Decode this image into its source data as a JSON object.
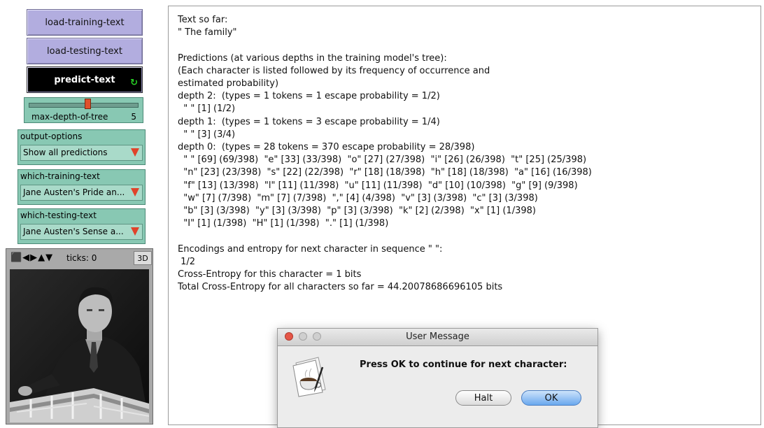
{
  "buttons": {
    "load_training": "load-training-text",
    "load_testing": "load-testing-text",
    "predict": "predict-text"
  },
  "slider": {
    "name": "max-depth-of-tree",
    "value": "5"
  },
  "choosers": {
    "output_options": {
      "label": "output-options",
      "selected": "Show all predictions"
    },
    "training_text": {
      "label": "which-training-text",
      "selected": "Jane Austen's Pride an..."
    },
    "testing_text": {
      "label": "which-testing-text",
      "selected": "Jane Austen's Sense a..."
    }
  },
  "view": {
    "ticks": "ticks: 0",
    "three_d": "3D"
  },
  "output_lines": [
    "Text so far:",
    "\" The family\"",
    "",
    "Predictions (at various depths in the training model's tree):",
    "(Each character is listed followed by its frequency of occurrence and",
    "estimated probability)",
    "depth 2:  (types = 1 tokens = 1 escape probability = 1/2)",
    "  \" \" [1] (1/2)",
    "depth 1:  (types = 1 tokens = 3 escape probability = 1/4)",
    "  \" \" [3] (3/4)",
    "depth 0:  (types = 28 tokens = 370 escape probability = 28/398)",
    "  \" \" [69] (69/398)  \"e\" [33] (33/398)  \"o\" [27] (27/398)  \"i\" [26] (26/398)  \"t\" [25] (25/398)",
    "  \"n\" [23] (23/398)  \"s\" [22] (22/398)  \"r\" [18] (18/398)  \"h\" [18] (18/398)  \"a\" [16] (16/398)",
    "  \"f\" [13] (13/398)  \"l\" [11] (11/398)  \"u\" [11] (11/398)  \"d\" [10] (10/398)  \"g\" [9] (9/398)",
    "  \"w\" [7] (7/398)  \"m\" [7] (7/398)  \",\" [4] (4/398)  \"v\" [3] (3/398)  \"c\" [3] (3/398)",
    "  \"b\" [3] (3/398)  \"y\" [3] (3/398)  \"p\" [3] (3/398)  \"k\" [2] (2/398)  \"x\" [1] (1/398)",
    "  \"I\" [1] (1/398)  \"H\" [1] (1/398)  \".\" [1] (1/398)",
    "",
    "Encodings and entropy for next character in sequence \" \":",
    " 1/2",
    "Cross-Entropy for this character = 1 bits",
    "Total Cross-Entropy for all characters so far = 44.20078686696105 bits"
  ],
  "dialog": {
    "title": "User Message",
    "message": "Press OK to continue for next character:",
    "halt": "Halt",
    "ok": "OK"
  },
  "icons": {
    "view_controls": "⬛◀▶▲▼",
    "forever": "↻"
  },
  "colors": {
    "button": "#b2addf",
    "widget_green": "#88c8b3",
    "slider_knob": "#e0502b",
    "chooser_arrow": "#e0432a",
    "ok_blue": "#6aa8ee"
  }
}
